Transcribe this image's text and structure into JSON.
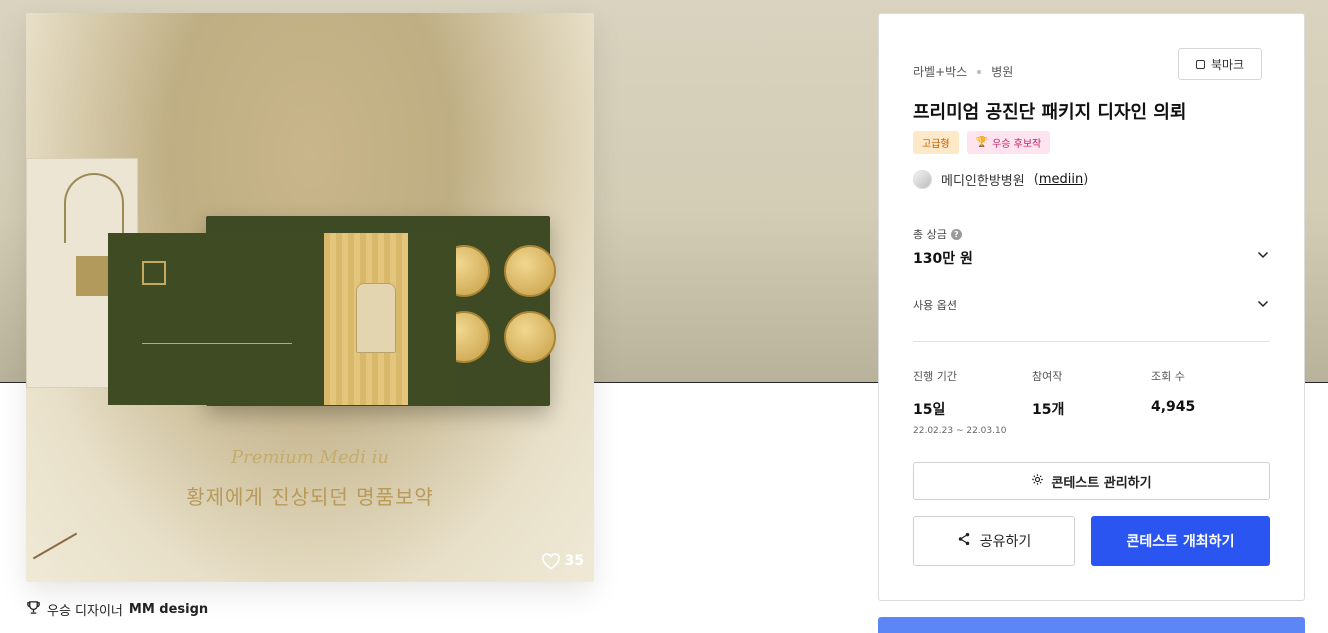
{
  "image": {
    "tagline_script": "Premium Medi iu",
    "tagline": "황제에게 진상되던 명품보약",
    "like_count": "35",
    "like_icon": "heart-icon"
  },
  "winner": {
    "icon": "trophy-icon",
    "label": "우승 디자이너",
    "name": "MM design"
  },
  "panel": {
    "breadcrumb": [
      "라벨+박스",
      "병원"
    ],
    "bookmark_label": "북마크",
    "title": "프리미엄 공진단 패키지 디자인 의뢰",
    "badges": {
      "grade": "고급형",
      "prize": "우승 후보작"
    },
    "host": {
      "name": "메디인한방병원",
      "handle": "mediin"
    },
    "total_prize_label": "총 상금",
    "total_prize_value": "130만 원",
    "options_label": "사용 옵션",
    "stats": [
      {
        "label": "진행 기간",
        "value": "15일",
        "sub": "22.02.23 ~ 22.03.10"
      },
      {
        "label": "참여작",
        "value": "15개",
        "sub": ""
      },
      {
        "label": "조회 수",
        "value": "4,945",
        "sub": ""
      }
    ],
    "manage_button": "콘테스트 관리하기",
    "share_button": "공유하기",
    "host_button": "콘테스트 개최하기"
  },
  "colors": {
    "primary": "#2a55f0",
    "grade_badge_bg": "#fde9c7",
    "prize_badge_bg": "#fde4ef"
  }
}
